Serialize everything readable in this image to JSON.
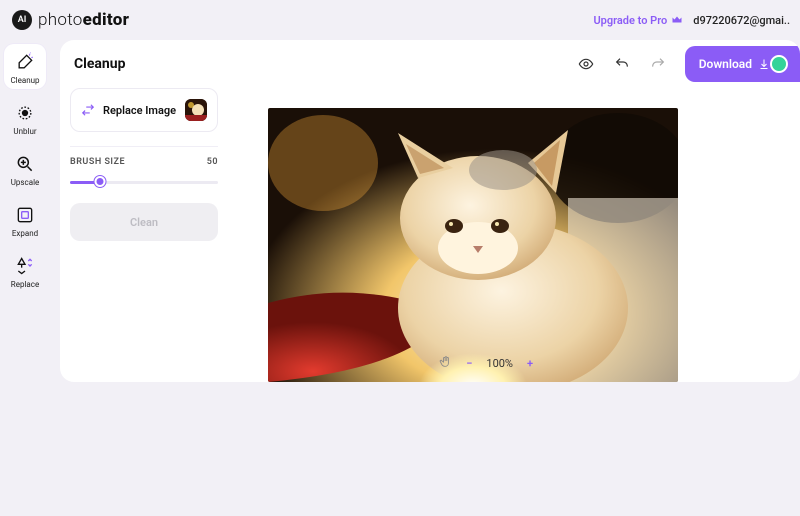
{
  "brand": {
    "mark": "AI",
    "word_a": "photo",
    "word_b": "editor"
  },
  "header": {
    "upgrade": "Upgrade to Pro",
    "email": "d97220672@gmai.."
  },
  "sidebar": {
    "items": [
      {
        "label": "Cleanup"
      },
      {
        "label": "Unblur"
      },
      {
        "label": "Upscale"
      },
      {
        "label": "Expand"
      },
      {
        "label": "Replace"
      }
    ]
  },
  "page": {
    "title": "Cleanup"
  },
  "toolbar": {
    "download": "Download"
  },
  "panel": {
    "replace_label": "Replace Image",
    "brush_label": "BRUSH SIZE",
    "brush_value": "50",
    "clean_label": "Clean"
  },
  "zoom": {
    "level": "100%",
    "minus": "−",
    "plus": "+"
  },
  "colors": {
    "accent": "#8b5cf6"
  }
}
